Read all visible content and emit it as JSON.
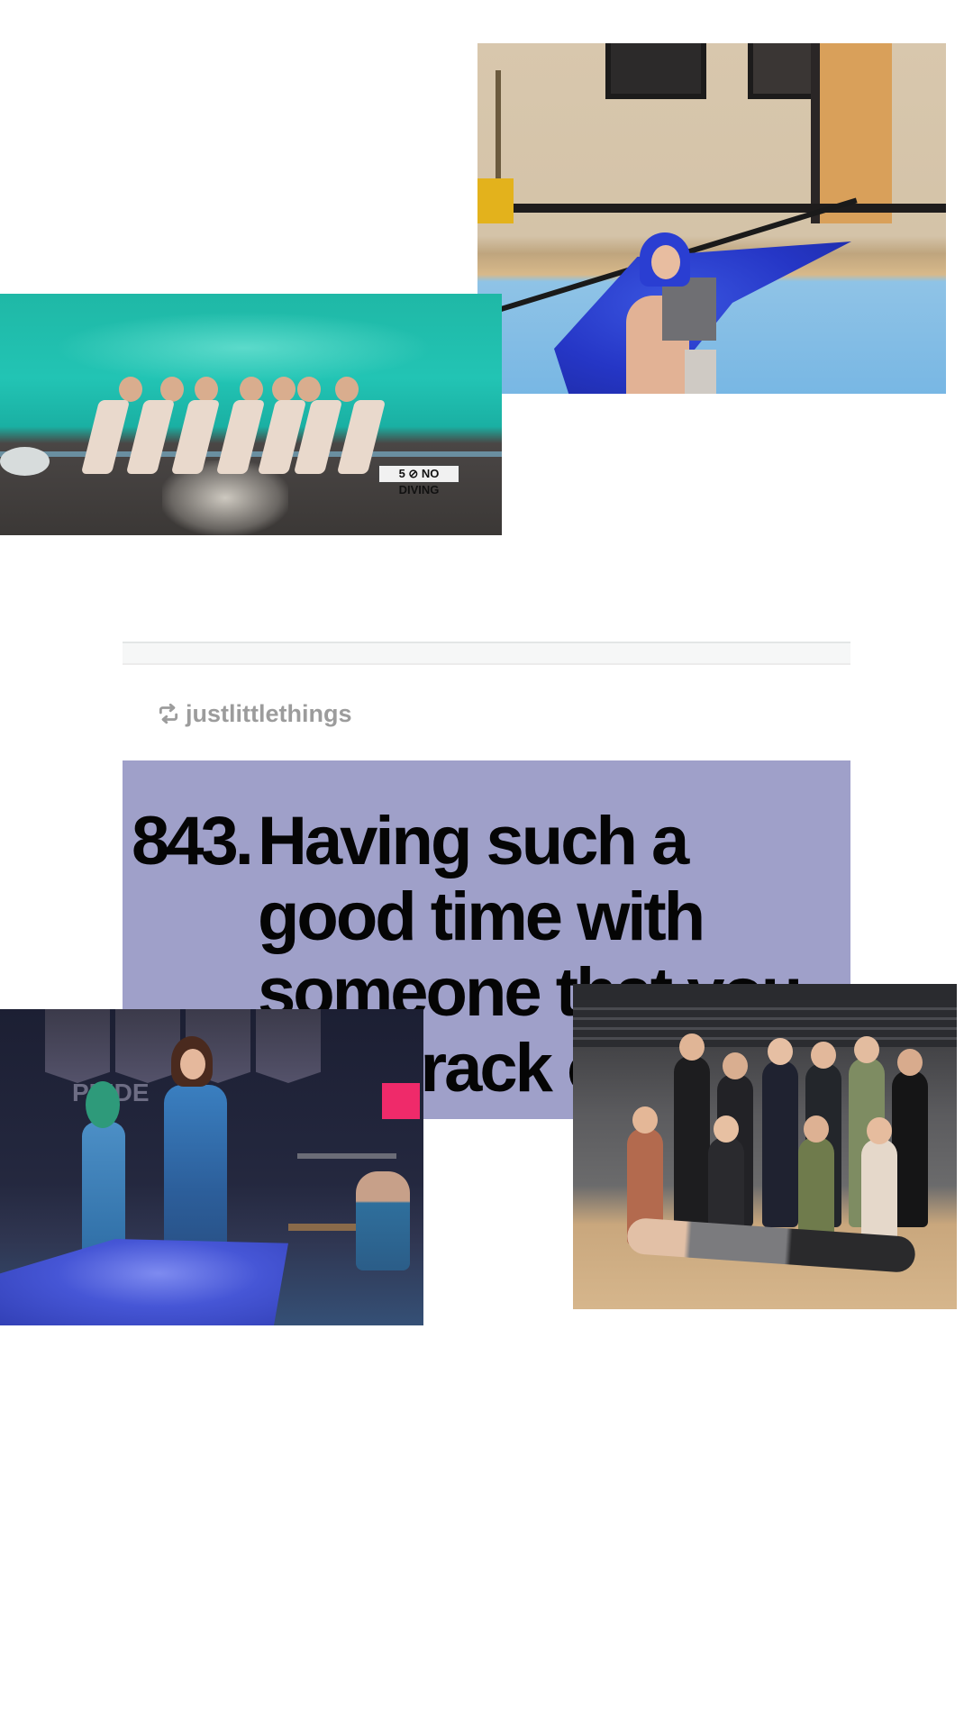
{
  "post": {
    "reblog_icon": "reblog-icon",
    "reblogged_from": "justlittlethings",
    "image_text": {
      "number": "843.",
      "text": "Having such a good time with someone that you lose track of time"
    }
  },
  "photos": [
    {
      "name": "practice-gym-photo"
    },
    {
      "name": "pool-group-photo"
    },
    {
      "name": "performance-photo"
    },
    {
      "name": "team-group-photo"
    }
  ],
  "pool_photo": {
    "depth_marker": "5 ⊘ NO DIVING"
  },
  "performance_photo": {
    "wall_letters": "PRIDE"
  },
  "colors": {
    "post_image_background": "#9fa0c9",
    "username_gray": "#9c9c9c",
    "divider": "#e3e6e6"
  }
}
